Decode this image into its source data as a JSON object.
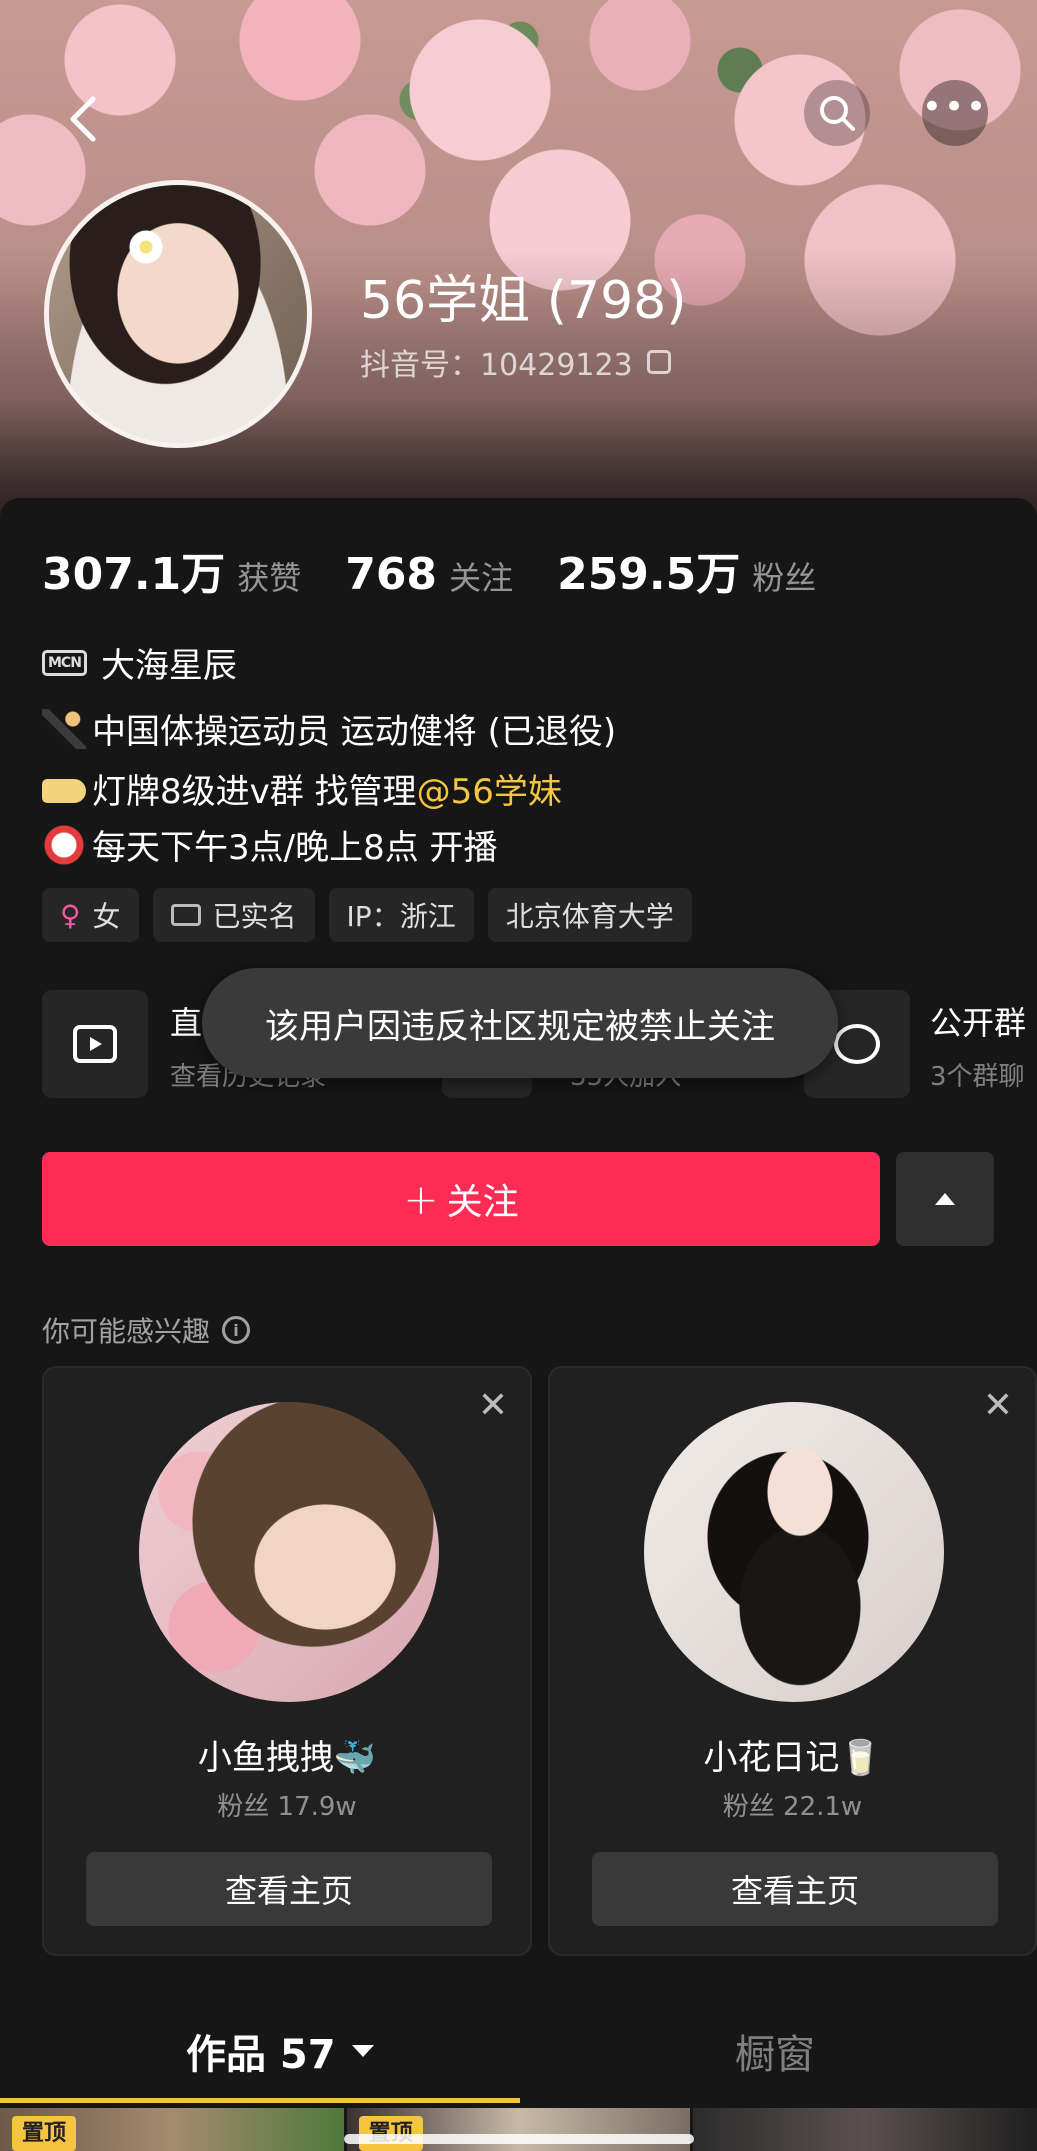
{
  "profile": {
    "name": "56学姐 (798)",
    "douyin_id_label": "抖音号：10429123"
  },
  "stats": [
    {
      "value": "307.1万",
      "label": "获赞"
    },
    {
      "value": "768",
      "label": "关注"
    },
    {
      "value": "259.5万",
      "label": "粉丝"
    }
  ],
  "mcn": {
    "badge": "MCN",
    "name": "大海星辰"
  },
  "bio": {
    "line1": "中国体操运动员 运动健将 (已退役)",
    "line2_prefix": "灯牌8级进v群 找管理",
    "line2_mention": "@56学妹",
    "line3": "每天下午3点/晚上8点 开播"
  },
  "tags": {
    "gender_symbol": "♀",
    "gender": "女",
    "verified": "已实名",
    "ip": "IP：浙江",
    "school": "北京体育大学"
  },
  "features": {
    "live_title": "直",
    "live_sub": "查看历史记录",
    "group_sub": "35人加入",
    "public_group_title": "公开群",
    "public_group_sub": "3个群聊"
  },
  "toast": "该用户因违反社区规定被禁止关注",
  "follow_button": {
    "plus": "+",
    "label": "关注"
  },
  "suggestions": {
    "title": "你可能感兴趣",
    "info_symbol": "i",
    "close_symbol": "✕",
    "items": [
      {
        "name": "小鱼拽拽🐳",
        "fans": "粉丝 17.9w",
        "button": "查看主页"
      },
      {
        "name": "小花日记🥛",
        "fans": "粉丝 22.1w",
        "button": "查看主页"
      }
    ]
  },
  "tabs": {
    "works": "作品 57",
    "shop": "橱窗"
  },
  "thumb_badge": "置顶",
  "colors": {
    "follow": "#fe2c55",
    "mention": "#f5c542",
    "tab_underline": "#f5c542"
  },
  "icons": [
    "back-icon",
    "search-icon",
    "more-icon",
    "copy-icon",
    "tv-icon",
    "chat-icon",
    "info-icon",
    "close-icon",
    "chevron-down-icon"
  ]
}
